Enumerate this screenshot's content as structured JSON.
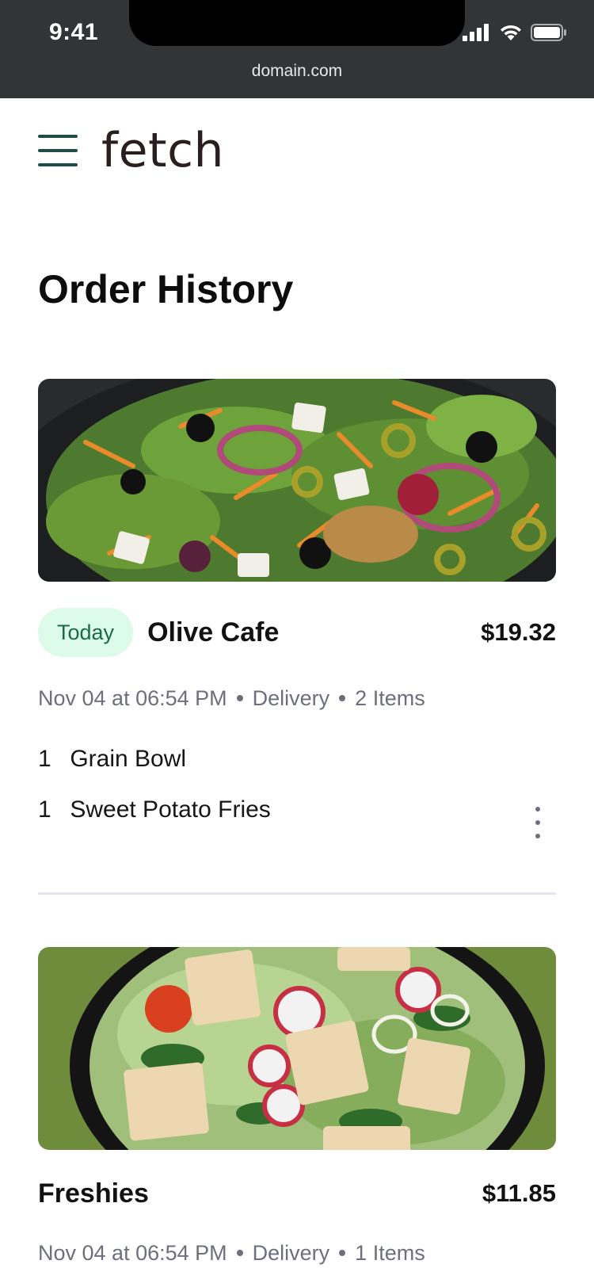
{
  "status_bar": {
    "time": "9:41",
    "icons": [
      "cellular-signal-icon",
      "wifi-icon",
      "battery-icon"
    ]
  },
  "browser": {
    "url": "domain.com"
  },
  "header": {
    "menu_icon": "hamburger-menu-icon",
    "logo": "fetch"
  },
  "page": {
    "title": "Order History"
  },
  "colors": {
    "brand_dark_green": "#1f4d44",
    "badge_bg": "#dcfbe8",
    "badge_text": "#1a6b45",
    "meta_text": "#6d6f7c",
    "divider": "#e4e5ec"
  },
  "orders": [
    {
      "badge": "Today",
      "restaurant": "Olive Cafe",
      "price": "$19.32",
      "date": "Nov 04 at 06:54 PM",
      "method": "Delivery",
      "item_count": "2 Items",
      "items": [
        {
          "qty": "1",
          "name": "Grain Bowl"
        },
        {
          "qty": "1",
          "name": "Sweet Potato Fries"
        }
      ],
      "image": "salad-photo-olives"
    },
    {
      "restaurant": "Freshies",
      "price": "$11.85",
      "date": "Nov 04 at 06:54 PM",
      "method": "Delivery",
      "item_count": "1 Items",
      "image": "salad-photo-pita"
    }
  ]
}
